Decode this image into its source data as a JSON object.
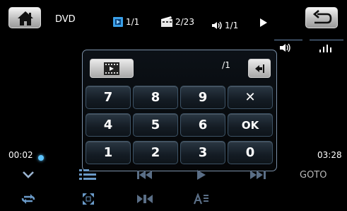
{
  "header": {
    "source_label": "DVD",
    "title_counter": "1/1",
    "chapter_counter": "2/23",
    "audio_counter": "1/1"
  },
  "keypad": {
    "input_value": "/1",
    "keys": [
      "7",
      "8",
      "9",
      "4",
      "5",
      "6",
      "1",
      "2",
      "3"
    ],
    "zero": "0",
    "clear_symbol": "✕",
    "ok_label": "OK"
  },
  "playback": {
    "elapsed": "00:02",
    "total": "03:28",
    "progress_fraction": 0.01,
    "goto_label": "GOTO"
  },
  "colors": {
    "accent": "#5cc4ff",
    "keypad_border": "#7a8fa8"
  },
  "icons": [
    "home-icon",
    "title-icon",
    "chapter-icon",
    "audio-icon",
    "play-status-icon",
    "back-icon",
    "volume-icon",
    "equalizer-icon",
    "video-menu-icon",
    "backspace-icon",
    "chevron-down-icon",
    "list-icon",
    "previous-icon",
    "play-icon",
    "next-icon",
    "repeat-icon",
    "zoom-icon",
    "stop-icon",
    "subtitle-icon"
  ]
}
